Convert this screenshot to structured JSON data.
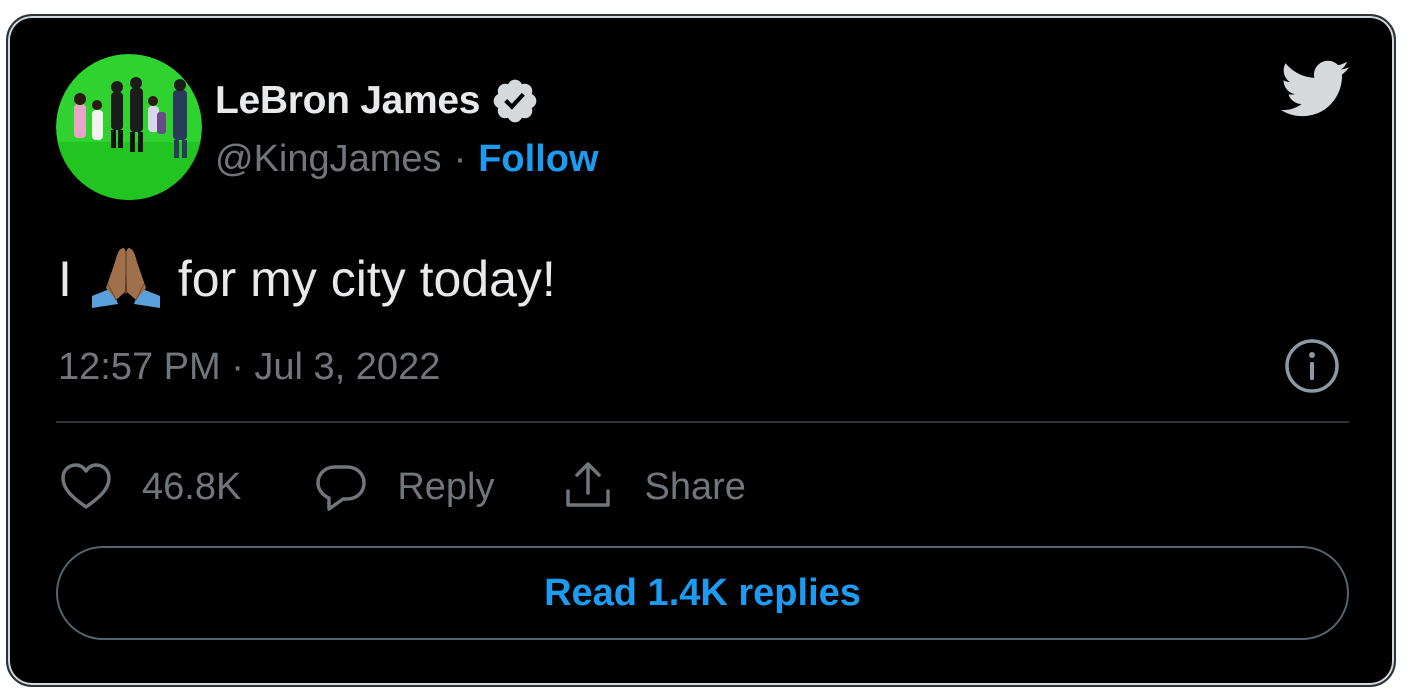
{
  "author": {
    "name": "LeBron James",
    "handle": "@KingJames",
    "separator": "·",
    "follow_label": "Follow",
    "verified": true
  },
  "tweet": {
    "text_before": "I",
    "emoji": "folded-hands-medium-dark-skin",
    "text_after": "for my city today!",
    "timestamp": "12:57 PM · Jul 3, 2022"
  },
  "actions": {
    "like_count": "46.8K",
    "reply_label": "Reply",
    "share_label": "Share"
  },
  "read_replies_label": "Read 1.4K replies",
  "icons": {
    "brand": "twitter-bird-icon",
    "info": "info-icon",
    "like": "heart-icon",
    "reply": "comment-bubble-icon",
    "share": "share-upload-icon"
  },
  "colors": {
    "background": "#000000",
    "text": "#e7e9ea",
    "muted": "#71767b",
    "accent": "#1d9bf0",
    "border": "#2f3336",
    "avatar_bg": "#2bd12b"
  }
}
